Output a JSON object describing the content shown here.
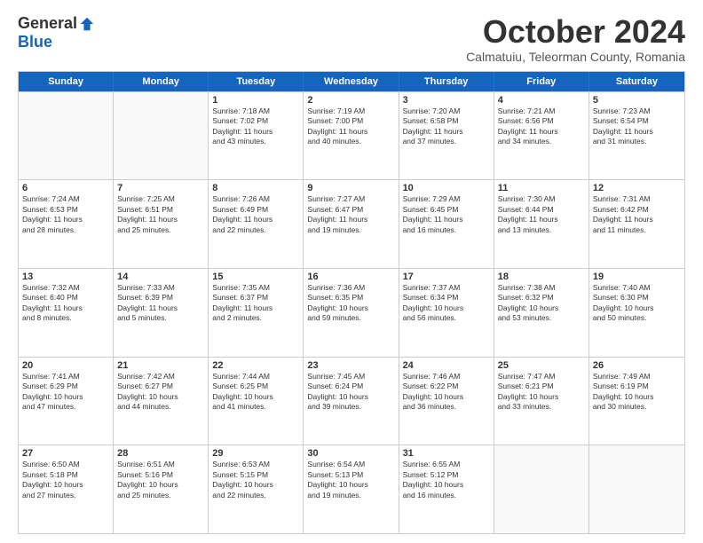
{
  "logo": {
    "general": "General",
    "blue": "Blue"
  },
  "title": "October 2024",
  "subtitle": "Calmatuiu, Teleorman County, Romania",
  "days": [
    "Sunday",
    "Monday",
    "Tuesday",
    "Wednesday",
    "Thursday",
    "Friday",
    "Saturday"
  ],
  "weeks": [
    [
      {
        "day": "",
        "empty": true
      },
      {
        "day": "",
        "empty": true
      },
      {
        "day": "1",
        "lines": [
          "Sunrise: 7:18 AM",
          "Sunset: 7:02 PM",
          "Daylight: 11 hours",
          "and 43 minutes."
        ]
      },
      {
        "day": "2",
        "lines": [
          "Sunrise: 7:19 AM",
          "Sunset: 7:00 PM",
          "Daylight: 11 hours",
          "and 40 minutes."
        ]
      },
      {
        "day": "3",
        "lines": [
          "Sunrise: 7:20 AM",
          "Sunset: 6:58 PM",
          "Daylight: 11 hours",
          "and 37 minutes."
        ]
      },
      {
        "day": "4",
        "lines": [
          "Sunrise: 7:21 AM",
          "Sunset: 6:56 PM",
          "Daylight: 11 hours",
          "and 34 minutes."
        ]
      },
      {
        "day": "5",
        "lines": [
          "Sunrise: 7:23 AM",
          "Sunset: 6:54 PM",
          "Daylight: 11 hours",
          "and 31 minutes."
        ]
      }
    ],
    [
      {
        "day": "6",
        "lines": [
          "Sunrise: 7:24 AM",
          "Sunset: 6:53 PM",
          "Daylight: 11 hours",
          "and 28 minutes."
        ]
      },
      {
        "day": "7",
        "lines": [
          "Sunrise: 7:25 AM",
          "Sunset: 6:51 PM",
          "Daylight: 11 hours",
          "and 25 minutes."
        ]
      },
      {
        "day": "8",
        "lines": [
          "Sunrise: 7:26 AM",
          "Sunset: 6:49 PM",
          "Daylight: 11 hours",
          "and 22 minutes."
        ]
      },
      {
        "day": "9",
        "lines": [
          "Sunrise: 7:27 AM",
          "Sunset: 6:47 PM",
          "Daylight: 11 hours",
          "and 19 minutes."
        ]
      },
      {
        "day": "10",
        "lines": [
          "Sunrise: 7:29 AM",
          "Sunset: 6:45 PM",
          "Daylight: 11 hours",
          "and 16 minutes."
        ]
      },
      {
        "day": "11",
        "lines": [
          "Sunrise: 7:30 AM",
          "Sunset: 6:44 PM",
          "Daylight: 11 hours",
          "and 13 minutes."
        ]
      },
      {
        "day": "12",
        "lines": [
          "Sunrise: 7:31 AM",
          "Sunset: 6:42 PM",
          "Daylight: 11 hours",
          "and 11 minutes."
        ]
      }
    ],
    [
      {
        "day": "13",
        "lines": [
          "Sunrise: 7:32 AM",
          "Sunset: 6:40 PM",
          "Daylight: 11 hours",
          "and 8 minutes."
        ]
      },
      {
        "day": "14",
        "lines": [
          "Sunrise: 7:33 AM",
          "Sunset: 6:39 PM",
          "Daylight: 11 hours",
          "and 5 minutes."
        ]
      },
      {
        "day": "15",
        "lines": [
          "Sunrise: 7:35 AM",
          "Sunset: 6:37 PM",
          "Daylight: 11 hours",
          "and 2 minutes."
        ]
      },
      {
        "day": "16",
        "lines": [
          "Sunrise: 7:36 AM",
          "Sunset: 6:35 PM",
          "Daylight: 10 hours",
          "and 59 minutes."
        ]
      },
      {
        "day": "17",
        "lines": [
          "Sunrise: 7:37 AM",
          "Sunset: 6:34 PM",
          "Daylight: 10 hours",
          "and 56 minutes."
        ]
      },
      {
        "day": "18",
        "lines": [
          "Sunrise: 7:38 AM",
          "Sunset: 6:32 PM",
          "Daylight: 10 hours",
          "and 53 minutes."
        ]
      },
      {
        "day": "19",
        "lines": [
          "Sunrise: 7:40 AM",
          "Sunset: 6:30 PM",
          "Daylight: 10 hours",
          "and 50 minutes."
        ]
      }
    ],
    [
      {
        "day": "20",
        "lines": [
          "Sunrise: 7:41 AM",
          "Sunset: 6:29 PM",
          "Daylight: 10 hours",
          "and 47 minutes."
        ]
      },
      {
        "day": "21",
        "lines": [
          "Sunrise: 7:42 AM",
          "Sunset: 6:27 PM",
          "Daylight: 10 hours",
          "and 44 minutes."
        ]
      },
      {
        "day": "22",
        "lines": [
          "Sunrise: 7:44 AM",
          "Sunset: 6:25 PM",
          "Daylight: 10 hours",
          "and 41 minutes."
        ]
      },
      {
        "day": "23",
        "lines": [
          "Sunrise: 7:45 AM",
          "Sunset: 6:24 PM",
          "Daylight: 10 hours",
          "and 39 minutes."
        ]
      },
      {
        "day": "24",
        "lines": [
          "Sunrise: 7:46 AM",
          "Sunset: 6:22 PM",
          "Daylight: 10 hours",
          "and 36 minutes."
        ]
      },
      {
        "day": "25",
        "lines": [
          "Sunrise: 7:47 AM",
          "Sunset: 6:21 PM",
          "Daylight: 10 hours",
          "and 33 minutes."
        ]
      },
      {
        "day": "26",
        "lines": [
          "Sunrise: 7:49 AM",
          "Sunset: 6:19 PM",
          "Daylight: 10 hours",
          "and 30 minutes."
        ]
      }
    ],
    [
      {
        "day": "27",
        "lines": [
          "Sunrise: 6:50 AM",
          "Sunset: 5:18 PM",
          "Daylight: 10 hours",
          "and 27 minutes."
        ]
      },
      {
        "day": "28",
        "lines": [
          "Sunrise: 6:51 AM",
          "Sunset: 5:16 PM",
          "Daylight: 10 hours",
          "and 25 minutes."
        ]
      },
      {
        "day": "29",
        "lines": [
          "Sunrise: 6:53 AM",
          "Sunset: 5:15 PM",
          "Daylight: 10 hours",
          "and 22 minutes."
        ]
      },
      {
        "day": "30",
        "lines": [
          "Sunrise: 6:54 AM",
          "Sunset: 5:13 PM",
          "Daylight: 10 hours",
          "and 19 minutes."
        ]
      },
      {
        "day": "31",
        "lines": [
          "Sunrise: 6:55 AM",
          "Sunset: 5:12 PM",
          "Daylight: 10 hours",
          "and 16 minutes."
        ]
      },
      {
        "day": "",
        "empty": true
      },
      {
        "day": "",
        "empty": true
      }
    ]
  ]
}
